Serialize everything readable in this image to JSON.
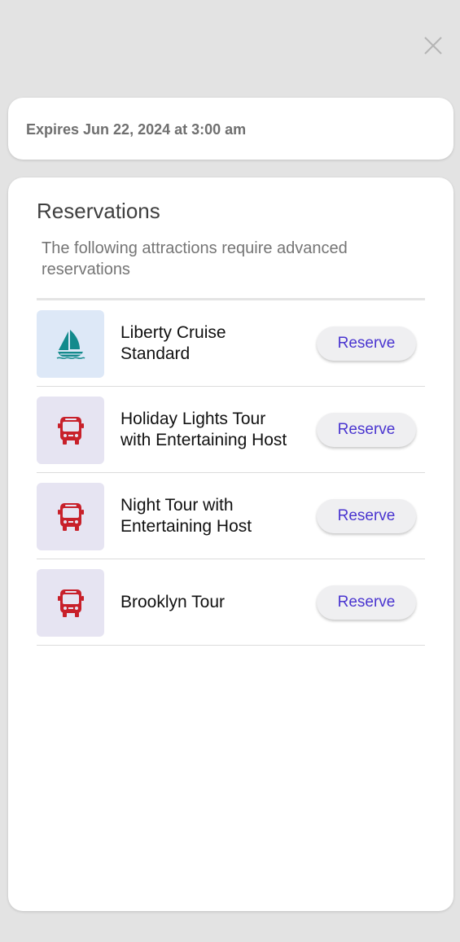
{
  "close": {
    "icon": "close-icon"
  },
  "expires": {
    "text": "Expires Jun 22, 2024 at 3:00 am"
  },
  "reservations": {
    "title": "Reservations",
    "subtitle": "The following attractions require advanced reservations",
    "items": [
      {
        "title": "Liberty Cruise Standard",
        "icon": "sailboat-icon",
        "button_label": "Reserve"
      },
      {
        "title": "Holiday Lights Tour with Entertaining Host",
        "icon": "bus-icon",
        "button_label": "Reserve"
      },
      {
        "title": "Night Tour with Entertaining Host",
        "icon": "bus-icon",
        "button_label": "Reserve"
      },
      {
        "title": "Brooklyn Tour",
        "icon": "bus-icon",
        "button_label": "Reserve"
      }
    ]
  },
  "colors": {
    "accent": "#4a35d0",
    "boat_icon": "#138a8c",
    "bus_icon": "#c8202a",
    "background": "#e3e3e3"
  }
}
